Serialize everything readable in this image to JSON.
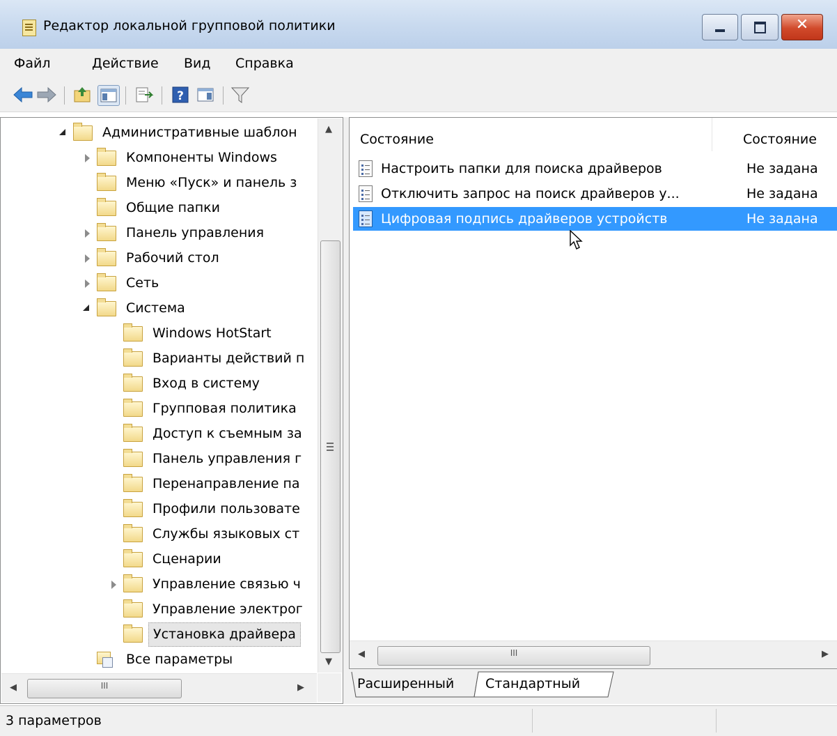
{
  "window": {
    "title": "Редактор локальной групповой политики"
  },
  "menu": [
    "Файл",
    "Действие",
    "Вид",
    "Справка"
  ],
  "tree": {
    "items": [
      {
        "label": "Административные шаблон",
        "state": "expanded",
        "level": 0
      },
      {
        "label": "Компоненты Windows",
        "state": "collapsed",
        "level": 1
      },
      {
        "label": "Меню «Пуск» и панель з",
        "state": "none",
        "level": 1
      },
      {
        "label": "Общие папки",
        "state": "none",
        "level": 1
      },
      {
        "label": "Панель управления",
        "state": "collapsed",
        "level": 1
      },
      {
        "label": "Рабочий стол",
        "state": "collapsed",
        "level": 1
      },
      {
        "label": "Сеть",
        "state": "collapsed",
        "level": 1
      },
      {
        "label": "Система",
        "state": "expanded",
        "level": 1
      },
      {
        "label": "Windows HotStart",
        "state": "none",
        "level": 2
      },
      {
        "label": "Варианты действий п",
        "state": "none",
        "level": 2
      },
      {
        "label": "Вход в систему",
        "state": "none",
        "level": 2
      },
      {
        "label": "Групповая политика",
        "state": "none",
        "level": 2
      },
      {
        "label": "Доступ к съемным за",
        "state": "none",
        "level": 2
      },
      {
        "label": "Панель управления г",
        "state": "none",
        "level": 2
      },
      {
        "label": "Перенаправление па",
        "state": "none",
        "level": 2
      },
      {
        "label": "Профили пользовате",
        "state": "none",
        "level": 2
      },
      {
        "label": "Службы языковых ст",
        "state": "none",
        "level": 2
      },
      {
        "label": "Сценарии",
        "state": "none",
        "level": 2
      },
      {
        "label": "Управление связью ч",
        "state": "collapsed",
        "level": 2
      },
      {
        "label": "Управление электрог",
        "state": "none",
        "level": 2
      },
      {
        "label": "Установка драйвера",
        "state": "selected",
        "level": 2
      },
      {
        "label": "Все параметры",
        "state": "allparams",
        "level": 1
      }
    ]
  },
  "list": {
    "columns": [
      "Состояние",
      "Состояние"
    ],
    "rows": [
      {
        "name": "Настроить папки для поиска драйверов",
        "state": "Не задана",
        "selected": false
      },
      {
        "name": "Отключить запрос на поиск драйверов у...",
        "state": "Не задана",
        "selected": false
      },
      {
        "name": "Цифровая подпись драйверов устройств",
        "state": "Не задана",
        "selected": true
      }
    ]
  },
  "tabs": [
    "Расширенный",
    "Стандартный"
  ],
  "status": {
    "text": "3 параметров"
  },
  "scroll": {
    "hscroll_grip": "III"
  },
  "colors": {
    "selection": "#3399ff",
    "titlebar": "#c9daef",
    "close": "#d14a2b"
  }
}
